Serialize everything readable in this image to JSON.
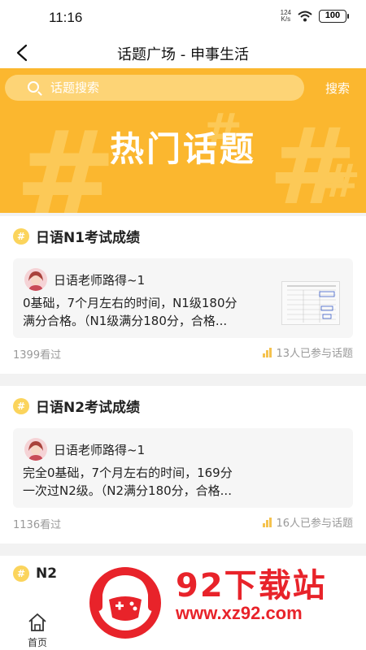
{
  "status_bar": {
    "time": "11:16",
    "net_speed_value": "124",
    "net_speed_unit": "K/s",
    "battery": "100"
  },
  "nav": {
    "title": "话题广场 - 申事生活"
  },
  "search": {
    "placeholder": "话题搜索",
    "button_label": "搜索"
  },
  "banner": {
    "title": "热门话题"
  },
  "topics": [
    {
      "badge": "#",
      "title": "日语N1考试成绩",
      "author": "日语老师路得~1",
      "text_line1": "0基础，7个月左右的时间，N1级180分",
      "text_line2": "满分合格。（N1级满分180分，合格...",
      "views": "1399看过",
      "participants": "13人已参与话题"
    },
    {
      "badge": "#",
      "title": "日语N2考试成绩",
      "author": "日语老师路得~1",
      "text_line1": "完全0基础，7个月左右的时间，169分",
      "text_line2": "一次过N2级。（N2满分180分，合格...",
      "views": "1136看过",
      "participants": "16人已参与话题"
    },
    {
      "badge": "#",
      "title": "N2"
    }
  ],
  "tab_bar": {
    "home_label": "首页"
  },
  "watermark": {
    "title": "92下载站",
    "url": "www.xz92.com"
  },
  "colors": {
    "banner": "#fbb72f",
    "accent": "#f5c24e",
    "watermark": "#e8232a"
  }
}
